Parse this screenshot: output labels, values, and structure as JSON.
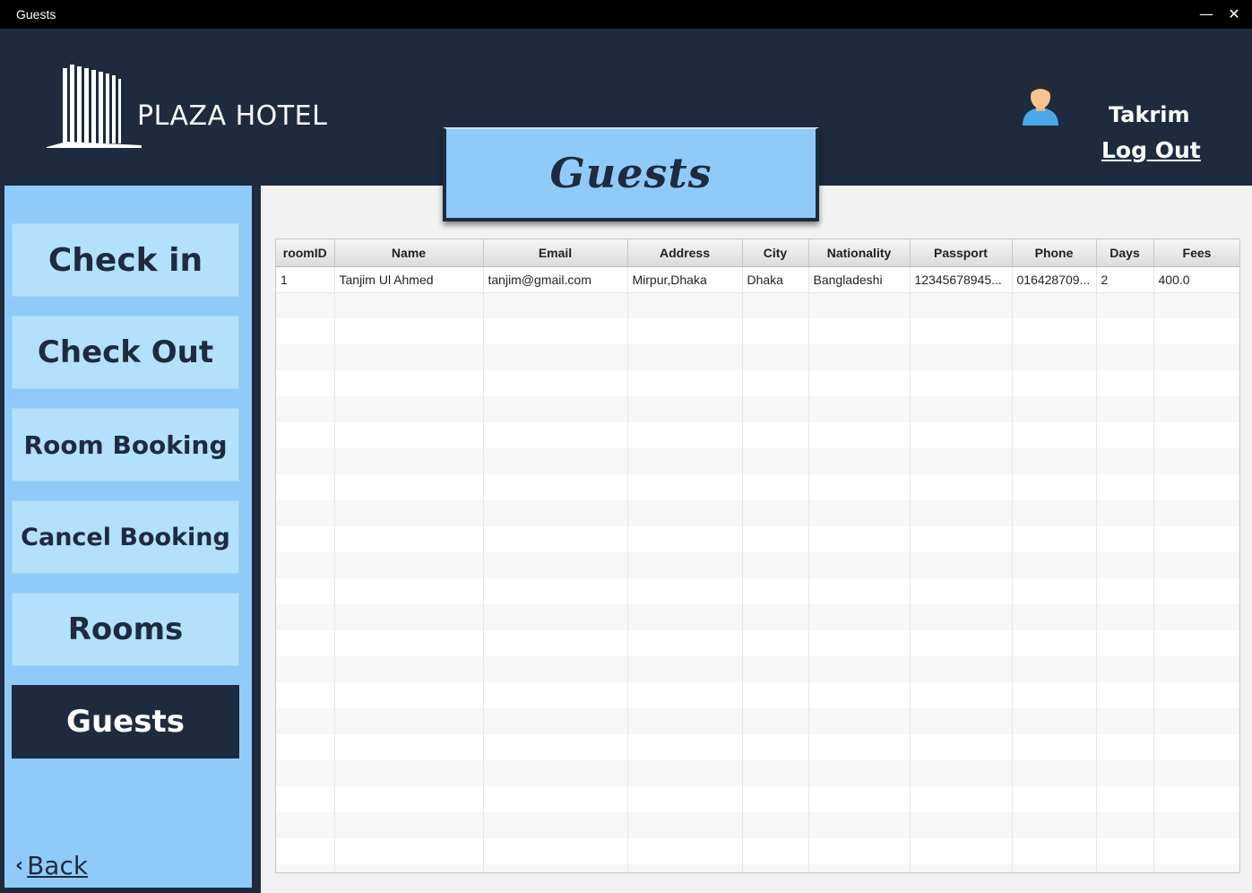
{
  "window": {
    "title": "Guests",
    "minimize": "—",
    "close": "✕"
  },
  "header": {
    "brand": "PLAZA HOTEL",
    "user": "Takrim",
    "logout": "Log Out"
  },
  "heading": "Guests",
  "sidebar": {
    "items": [
      {
        "label": "Check in",
        "active": false
      },
      {
        "label": "Check Out",
        "active": false
      },
      {
        "label": "Room Booking",
        "active": false
      },
      {
        "label": "Cancel Booking",
        "active": false
      },
      {
        "label": "Rooms",
        "active": false
      },
      {
        "label": "Guests",
        "active": true
      }
    ],
    "back": "Back"
  },
  "table": {
    "columns": [
      "roomID",
      "Name",
      "Email",
      "Address",
      "City",
      "Nationality",
      "Passport",
      "Phone",
      "Days",
      "Fees"
    ],
    "rows": [
      [
        "1",
        "Tanjim Ul Ahmed",
        "tanjim@gmail.com",
        "Mirpur,Dhaka",
        "Dhaka",
        "Bangladeshi",
        "12345678945...",
        "016428709...",
        "2",
        "400.0"
      ]
    ]
  },
  "colors": {
    "navy": "#1e2b3f",
    "sky": "#90caf9",
    "button": "#b3e0fb"
  }
}
